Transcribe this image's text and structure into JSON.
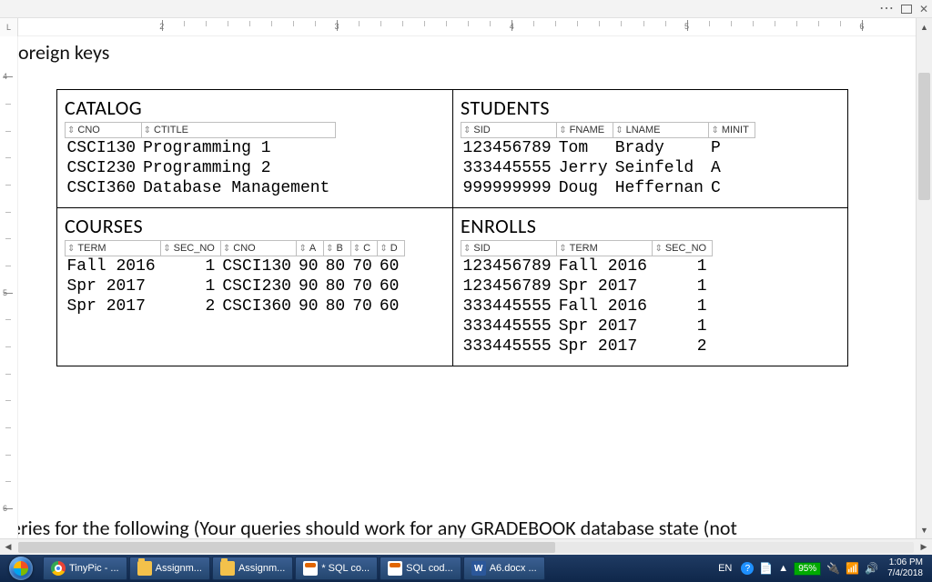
{
  "app_chrome": {
    "more": "...",
    "restore": "❐",
    "close": "X"
  },
  "ruler": {
    "labels": [
      "2",
      "3",
      "4",
      "5",
      "6"
    ]
  },
  "vruler": {
    "labels": [
      "4",
      "5",
      "6"
    ]
  },
  "doc": {
    "frag_top": "oreign keys",
    "frag_bottom": "eries for the following (Your queries should work for any GRADEBOOK database state (not"
  },
  "tables": {
    "catalog": {
      "title": "CATALOG",
      "headers": [
        "CNO",
        "CTITLE"
      ],
      "rows": [
        [
          "CSCI130",
          "Programming 1"
        ],
        [
          "CSCI230",
          "Programming 2"
        ],
        [
          "CSCI360",
          "Database Management"
        ]
      ]
    },
    "students": {
      "title": "STUDENTS",
      "headers": [
        "SID",
        "FNAME",
        "LNAME",
        "MINIT"
      ],
      "rows": [
        [
          "123456789",
          "Tom",
          "Brady",
          "P"
        ],
        [
          "333445555",
          "Jerry",
          "Seinfeld",
          "A"
        ],
        [
          "999999999",
          "Doug",
          "Heffernan",
          "C"
        ]
      ]
    },
    "courses": {
      "title": "COURSES",
      "headers": [
        "TERM",
        "SEC_NO",
        "CNO",
        "A",
        "B",
        "C",
        "D"
      ],
      "rows": [
        [
          "Fall 2016",
          "1",
          "CSCI130",
          "90",
          "80",
          "70",
          "60"
        ],
        [
          "Spr 2017",
          "1",
          "CSCI230",
          "90",
          "80",
          "70",
          "60"
        ],
        [
          "Spr 2017",
          "2",
          "CSCI360",
          "90",
          "80",
          "70",
          "60"
        ]
      ],
      "numcols": [
        1,
        3,
        4,
        5,
        6
      ]
    },
    "enrolls": {
      "title": "ENROLLS",
      "headers": [
        "SID",
        "TERM",
        "SEC_NO"
      ],
      "rows": [
        [
          "123456789",
          "Fall 2016",
          "1"
        ],
        [
          "123456789",
          "Spr 2017",
          "1"
        ],
        [
          "333445555",
          "Fall 2016",
          "1"
        ],
        [
          "333445555",
          "Spr 2017",
          "1"
        ],
        [
          "333445555",
          "Spr 2017",
          "2"
        ]
      ],
      "numcols": [
        2
      ]
    }
  },
  "taskbar": {
    "items": [
      {
        "icon": "chrome",
        "label": "TinyPic - ..."
      },
      {
        "icon": "folder",
        "label": "Assignm..."
      },
      {
        "icon": "folder",
        "label": "Assignm..."
      },
      {
        "icon": "sql",
        "label": "* SQL co..."
      },
      {
        "icon": "sql",
        "label": "SQL cod..."
      },
      {
        "icon": "word",
        "label": "A6.docx ..."
      }
    ],
    "lang": "EN",
    "battery": "95%",
    "time": "1:06 PM",
    "date": "7/4/2018"
  }
}
